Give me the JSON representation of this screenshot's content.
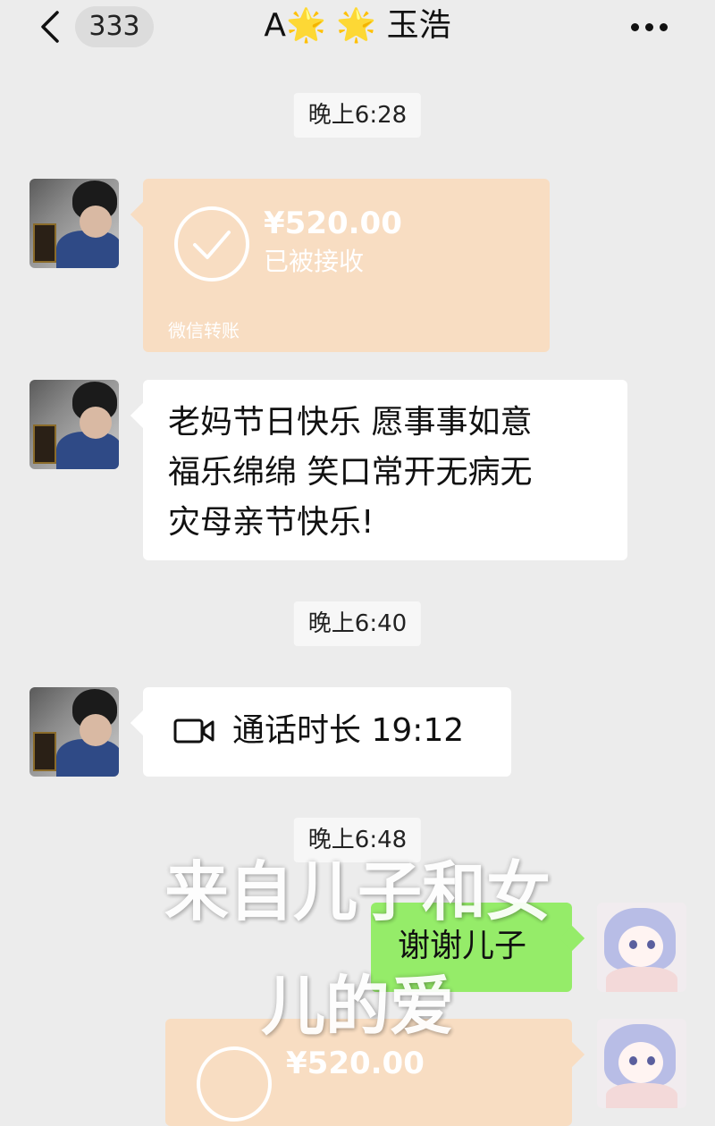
{
  "header": {
    "back_label": "back",
    "unread_count": "333",
    "title": "A🌟 🌟 玉浩",
    "more_label": "more"
  },
  "messages": {
    "time1": "晚上6:28",
    "transfer1": {
      "amount": "¥520.00",
      "status": "已被接收",
      "source": "微信转账"
    },
    "text1": " 老妈节日快乐 愿事事如意\n福乐绵绵 笑口常开无病无\n灾母亲节快乐!",
    "time2": "晚上6:40",
    "call": {
      "label": "通话时长 19:12"
    },
    "time3": "晚上6:48",
    "reply": "谢谢儿子",
    "transfer2": {
      "amount": "¥520.00"
    }
  },
  "overlay": {
    "line1": "来自儿子和女",
    "line2": "儿的爱"
  },
  "colors": {
    "background": "#ececec",
    "transfer_bubble": "#f8ddc2",
    "sent_bubble": "#95ec69"
  }
}
